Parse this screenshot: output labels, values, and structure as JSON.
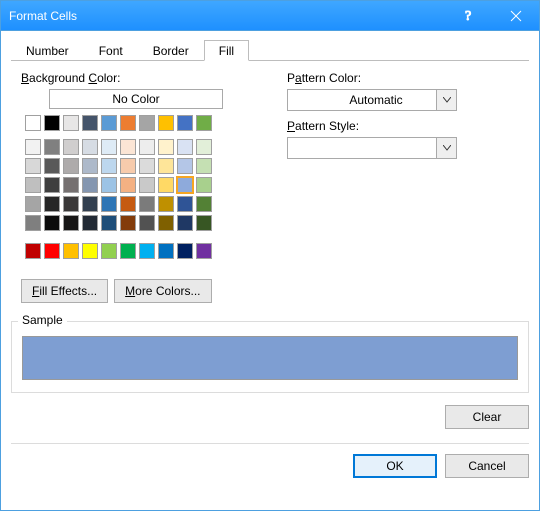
{
  "title": "Format Cells",
  "tabs": [
    "Number",
    "Font",
    "Border",
    "Fill"
  ],
  "active_tab": 3,
  "left": {
    "bg_label": "Background Color:",
    "no_color": "No Color",
    "fill_effects": "Fill Effects...",
    "more_colors": "More Colors..."
  },
  "right": {
    "pattern_color_label": "Pattern Color:",
    "pattern_color_value": "Automatic",
    "pattern_style_label": "Pattern Style:",
    "pattern_style_value": ""
  },
  "sample_label": "Sample",
  "sample_color": "#7e9ed2",
  "buttons": {
    "clear": "Clear",
    "ok": "OK",
    "cancel": "Cancel"
  },
  "palette_theme_row": [
    "#ffffff",
    "#000000",
    "#e7e6e6",
    "#44546a",
    "#5b9bd5",
    "#ed7d31",
    "#a5a5a5",
    "#ffc000",
    "#4472c4",
    "#70ad47"
  ],
  "palette_tints": [
    [
      "#f2f2f2",
      "#808080",
      "#d0cece",
      "#d6dce4",
      "#deebf6",
      "#fbe5d5",
      "#ededed",
      "#fff2cc",
      "#d9e2f3",
      "#e2efd9"
    ],
    [
      "#d8d8d8",
      "#595959",
      "#aeabab",
      "#adb9ca",
      "#bdd7ee",
      "#f7cbac",
      "#dbdbdb",
      "#fee599",
      "#b4c6e7",
      "#c5e0b3"
    ],
    [
      "#bfbfbf",
      "#3f3f3f",
      "#757070",
      "#8496b0",
      "#9cc3e5",
      "#f4b183",
      "#c9c9c9",
      "#ffd965",
      "#8eaadb",
      "#a8d08d"
    ],
    [
      "#a5a5a5",
      "#262626",
      "#3a3838",
      "#323f4f",
      "#2e75b5",
      "#c55a11",
      "#7b7b7b",
      "#bf9000",
      "#2f5496",
      "#538135"
    ],
    [
      "#7f7f7f",
      "#0c0c0c",
      "#171616",
      "#222a35",
      "#1e4e79",
      "#833c0b",
      "#525252",
      "#7f6000",
      "#1f3864",
      "#375623"
    ]
  ],
  "palette_standard": [
    "#c00000",
    "#ff0000",
    "#ffc000",
    "#ffff00",
    "#92d050",
    "#00b050",
    "#00b0f0",
    "#0070c0",
    "#002060",
    "#7030a0"
  ],
  "selected_tint": {
    "row": 2,
    "col": 8
  }
}
